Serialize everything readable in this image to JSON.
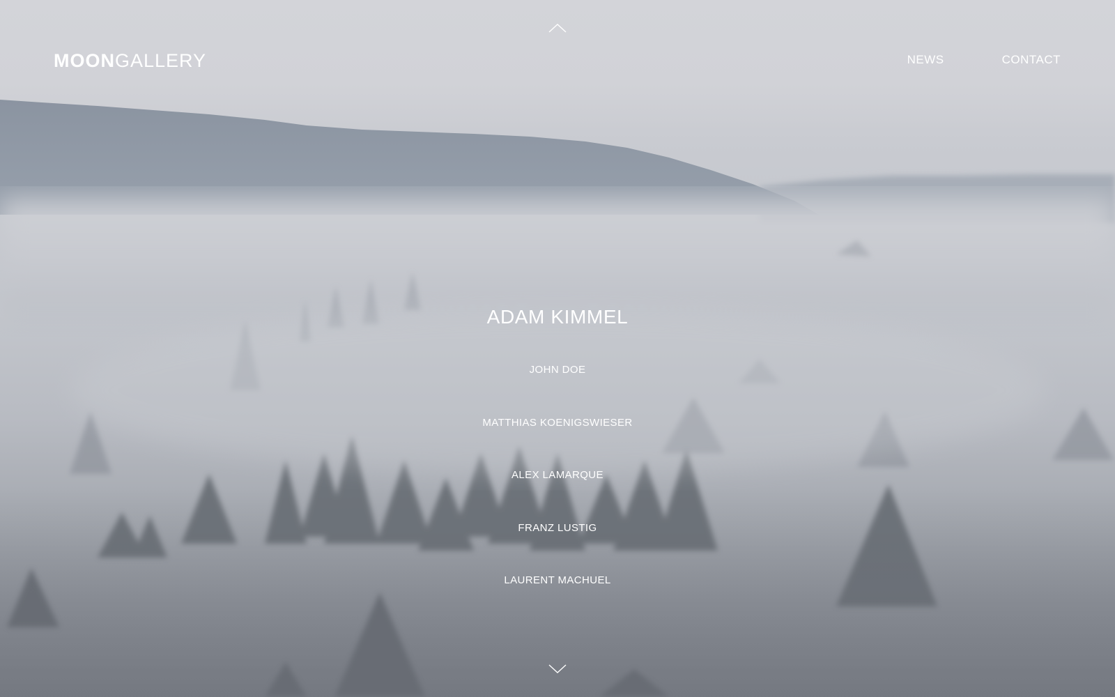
{
  "brand": {
    "part1": "MOON",
    "part2": "GALLERY"
  },
  "nav": {
    "news": "NEWS",
    "contact": "CONTACT"
  },
  "icons": {
    "up": "chevron-up-icon",
    "down": "chevron-down-icon"
  },
  "artists": {
    "featured": "ADAM KIMMEL",
    "list": [
      "JOHN DOE",
      "MATTHIAS KOENIGSWIESER",
      "ALEX LAMARQUE",
      "FRANZ LUSTIG",
      "LAURENT MACHUEL"
    ]
  },
  "colors": {
    "text": "#ffffff",
    "sky": "#d3d4d9",
    "hill": "#8f98a5",
    "fog": "#c4c7cd",
    "trees": "#5f646c"
  }
}
